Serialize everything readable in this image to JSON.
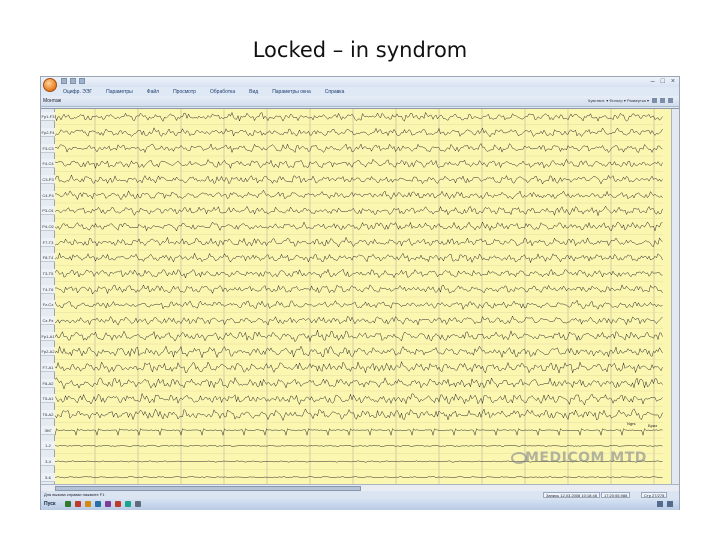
{
  "slide": {
    "title": "Locked – in syndrom"
  },
  "app": {
    "menu": [
      "Оцифр. ЭЭГ",
      "Параметры",
      "Файл",
      "Просмотр",
      "Обработка",
      "Вид",
      "Параметры окна",
      "Справка"
    ],
    "mode_label": "Монтаж",
    "ribbon_text": "Чувствит. ▾  Фильтр ▾  Развертка ▾"
  },
  "channels": [
    "Fp1-F3",
    "Fp2-F4",
    "F3-C3",
    "F4-C4",
    "C3-P3",
    "C4-P4",
    "P3-O1",
    "P4-O2",
    "F7-T3",
    "F8-T4",
    "T3-T5",
    "T4-T6",
    "Fz-Cz",
    "Cz-Pz",
    "Fp1-A1",
    "Fp2-A2",
    "F7-A1",
    "F8-A2",
    "T5-A1",
    "T6-A2",
    "ЭКГ",
    "1-2",
    "3-4",
    "5-6"
  ],
  "markers": {
    "left": "Ngrs",
    "right": "Бриз"
  },
  "watermark": "MEDICOM MTD",
  "status": {
    "left": "Для вызова справки нажмите F1",
    "date": "Запись 12.03.2008 10:18:48",
    "time": "17:20:55.988",
    "page": "Стр 27/278"
  },
  "taskbar": {
    "start": "Пуск"
  }
}
